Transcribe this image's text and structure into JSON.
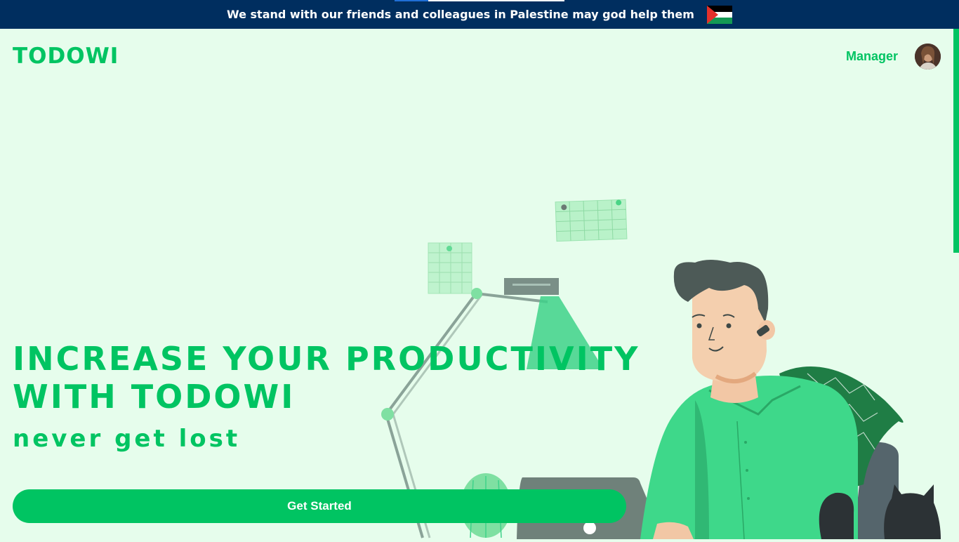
{
  "banner": {
    "message": "We stand with our friends and colleagues in Palestine may god help them",
    "flag_icon": "palestine-flag-icon",
    "background": "#002e5f"
  },
  "header": {
    "logo": "TODOWI",
    "nav_link": "Manager",
    "avatar_icon": "user-avatar"
  },
  "hero": {
    "title_line1": "Increase your productivity",
    "title_line2": "with todowi",
    "subtitle": "never get lost",
    "cta_label": "Get Started",
    "illustration": "man-working-at-laptop-illustration"
  },
  "colors": {
    "accent": "#00c462",
    "page_background": "#e6fdec",
    "banner_background": "#002e5f"
  }
}
